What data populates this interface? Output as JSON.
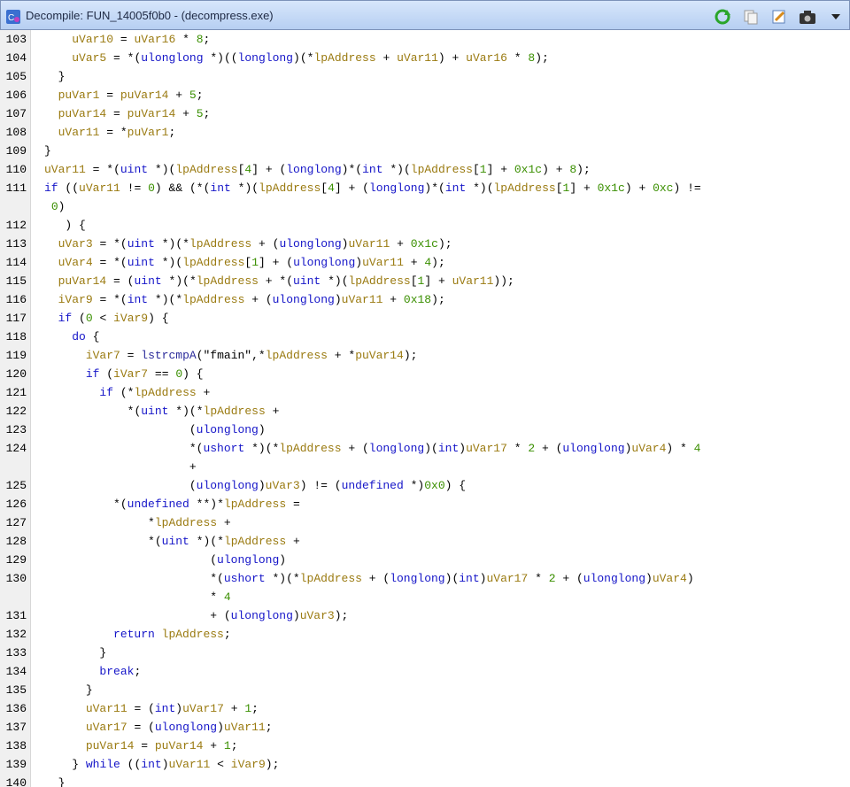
{
  "window": {
    "title": "Decompile: FUN_14005f0b0 - (decompress.exe)"
  },
  "toolbar": {
    "refresh_icon": "refresh-icon",
    "copy_icon": "copy-icon",
    "edit_icon": "edit-icon",
    "snapshot_icon": "camera-icon",
    "menu_icon": "chevron-down-icon"
  },
  "code": {
    "lines": [
      {
        "n": "103",
        "t": "    uVar10 = uVar16 * 8;"
      },
      {
        "n": "104",
        "t": "    uVar5 = *(ulonglong *)((longlong)(*lpAddress + uVar11) + uVar16 * 8);"
      },
      {
        "n": "105",
        "t": "  }"
      },
      {
        "n": "106",
        "t": "  puVar1 = puVar14 + 5;"
      },
      {
        "n": "107",
        "t": "  puVar14 = puVar14 + 5;"
      },
      {
        "n": "108",
        "t": "  uVar11 = *puVar1;"
      },
      {
        "n": "109",
        "t": "}"
      },
      {
        "n": "110",
        "t": "uVar11 = *(uint *)(lpAddress[4] + (longlong)*(int *)(lpAddress[1] + 0x1c) + 8);"
      },
      {
        "n": "111",
        "t": "if ((uVar11 != 0) && (*(int *)(lpAddress[4] + (longlong)*(int *)(lpAddress[1] + 0x1c) + 0xc) !="
      },
      {
        "n": "",
        "t": " 0)"
      },
      {
        "n": "112",
        "t": "   ) {"
      },
      {
        "n": "113",
        "t": "  uVar3 = *(uint *)(*lpAddress + (ulonglong)uVar11 + 0x1c);"
      },
      {
        "n": "114",
        "t": "  uVar4 = *(uint *)(lpAddress[1] + (ulonglong)uVar11 + 4);"
      },
      {
        "n": "115",
        "t": "  puVar14 = (uint *)(*lpAddress + *(uint *)(lpAddress[1] + uVar11));"
      },
      {
        "n": "116",
        "t": "  iVar9 = *(int *)(*lpAddress + (ulonglong)uVar11 + 0x18);"
      },
      {
        "n": "117",
        "t": "  if (0 < iVar9) {"
      },
      {
        "n": "118",
        "t": "    do {"
      },
      {
        "n": "119",
        "t": "      iVar7 = lstrcmpA(\"fmain\",*lpAddress + *puVar14);"
      },
      {
        "n": "120",
        "t": "      if (iVar7 == 0) {"
      },
      {
        "n": "121",
        "t": "        if (*lpAddress +"
      },
      {
        "n": "122",
        "t": "            *(uint *)(*lpAddress +"
      },
      {
        "n": "123",
        "t": "                     (ulonglong)"
      },
      {
        "n": "124",
        "t": "                     *(ushort *)(*lpAddress + (longlong)(int)uVar17 * 2 + (ulonglong)uVar4) * 4"
      },
      {
        "n": "",
        "t": "                     +"
      },
      {
        "n": "125",
        "t": "                     (ulonglong)uVar3) != (undefined *)0x0) {"
      },
      {
        "n": "126",
        "t": "          *(undefined **)*lpAddress ="
      },
      {
        "n": "127",
        "t": "               *lpAddress +"
      },
      {
        "n": "128",
        "t": "               *(uint *)(*lpAddress +"
      },
      {
        "n": "129",
        "t": "                        (ulonglong)"
      },
      {
        "n": "130",
        "t": "                        *(ushort *)(*lpAddress + (longlong)(int)uVar17 * 2 + (ulonglong)uVar4)"
      },
      {
        "n": "",
        "t": "                        * 4"
      },
      {
        "n": "131",
        "t": "                        + (ulonglong)uVar3);"
      },
      {
        "n": "132",
        "t": "          return lpAddress;"
      },
      {
        "n": "133",
        "t": "        }"
      },
      {
        "n": "134",
        "t": "        break;"
      },
      {
        "n": "135",
        "t": "      }"
      },
      {
        "n": "136",
        "t": "      uVar11 = (int)uVar17 + 1;"
      },
      {
        "n": "137",
        "t": "      uVar17 = (ulonglong)uVar11;"
      },
      {
        "n": "138",
        "t": "      puVar14 = puVar14 + 1;"
      },
      {
        "n": "139",
        "t": "    } while ((int)uVar11 < iVar9);"
      },
      {
        "n": "140",
        "t": "  }"
      }
    ]
  },
  "colors": {
    "keyword": "#1515c8",
    "variable": "#9a7a10",
    "number": "#3a8f00"
  }
}
